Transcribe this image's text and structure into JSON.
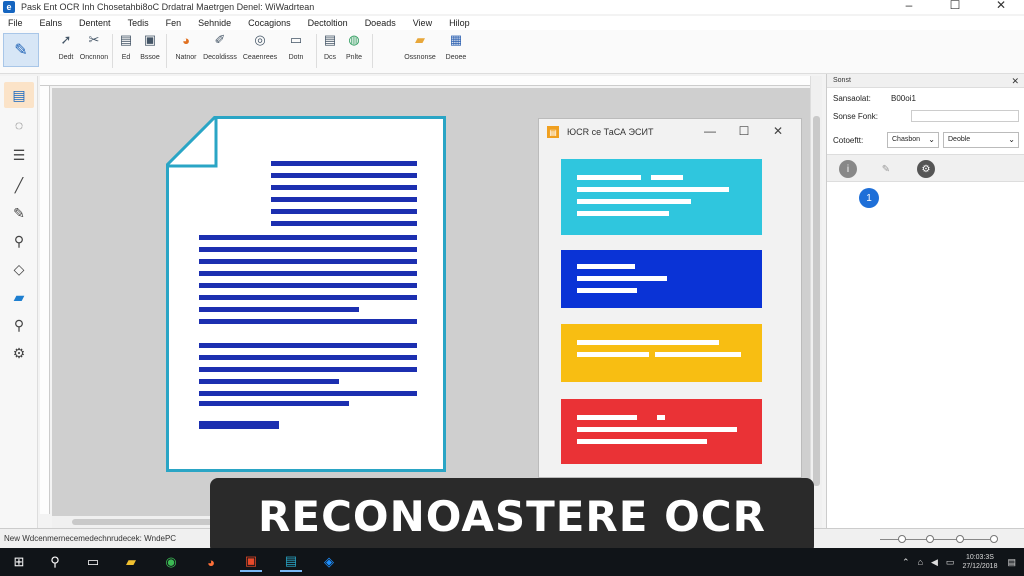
{
  "window": {
    "app_icon": "app-logo-icon",
    "title": "Pask Ent OCR Inh Chosetahbi8oC Drdatral Maetrgen Denel: WiWadrtean",
    "controls": [
      "–",
      "☐",
      "✕"
    ]
  },
  "menu": [
    "File",
    "Ealns",
    "Dentent",
    "Tedis",
    "Fen",
    "Sehnide",
    "Cocagions",
    "Dectoltion",
    "Doeads",
    "View",
    "Hilop"
  ],
  "toolbar": {
    "buttons": [
      {
        "label": "Dedt",
        "icon": "arrow-icon"
      },
      {
        "label": "Oncnnon",
        "icon": "tools-icon"
      },
      {
        "label": "Ed",
        "icon": "page-icon"
      },
      {
        "label": "Bssoe",
        "icon": "scan-icon"
      },
      {
        "label": "Natnor",
        "sub": "ob",
        "icon": "color-wheel-icon"
      },
      {
        "label": "Decoldisss",
        "icon": "brush-icon"
      },
      {
        "label": "Ceaenrees",
        "icon": "search-globe-icon"
      },
      {
        "label": "Dotn",
        "icon": "image-icon"
      },
      {
        "label": "Dcs",
        "icon": "doc-icon"
      },
      {
        "label": "Pnlte",
        "icon": "refresh-icon"
      },
      {
        "label": "Ossnonse",
        "icon": "folder-icon"
      },
      {
        "label": "Deoee",
        "icon": "window-icon"
      }
    ]
  },
  "tools": [
    "document-icon",
    "lasso-icon",
    "text-block-icon",
    "pen-icon",
    "eyedropper-icon",
    "brush-tool-icon",
    "eraser-icon",
    "image-tool-icon",
    "zoom-icon",
    "clone-icon"
  ],
  "ocr_window": {
    "title": "ЮCR ce ТаСА ЭСИТ",
    "controls": [
      "—",
      "☐",
      "✕"
    ],
    "cards": [
      {
        "color": "#2fc6de",
        "name": "cyan"
      },
      {
        "color": "#0a33d6",
        "name": "blue"
      },
      {
        "color": "#f8be12",
        "name": "yellow"
      },
      {
        "color": "#ea3236",
        "name": "red"
      }
    ]
  },
  "document": {
    "border_color": "#2aa5c5",
    "line_color": "#1c2fb0"
  },
  "right_panel": {
    "header": "Sonst",
    "rows": [
      {
        "label": "Sansaolat:",
        "value": "B00oi1"
      },
      {
        "label": "Sonse Fonk:",
        "value": ""
      }
    ],
    "select_label": "Cotoeftt:",
    "select1": "Chasbon",
    "select2": "Deoble",
    "icons": [
      "info-icon",
      "pencil-icon",
      "settings-icon"
    ],
    "badge": "1"
  },
  "statusbar": {
    "text": "New Wdcenmernecemedechnrudecek: WndePC"
  },
  "banner": {
    "text": "RECONOASTERE OCR"
  },
  "taskbar": {
    "items": [
      "windows-start-icon",
      "search-icon",
      "task-view-icon",
      "file-explorer-icon",
      "chrome-icon",
      "firefox-icon",
      "app-icon",
      "ocr-app-icon",
      "edge-icon"
    ],
    "clock_time": "10:03:3S",
    "clock_date": "27/12/2018"
  }
}
